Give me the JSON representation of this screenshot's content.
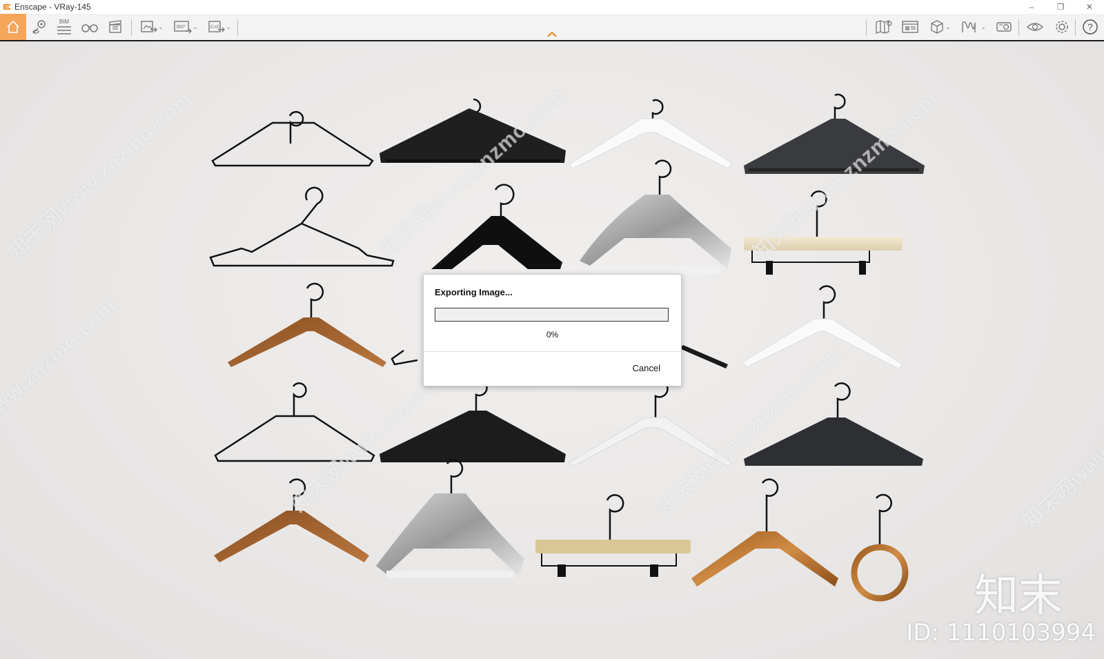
{
  "window": {
    "title": "Enscape - VRay-145",
    "minimize_icon": "minimize-icon",
    "restore_icon": "restore-icon",
    "close_icon": "close-icon"
  },
  "toolbar": {
    "accent_color": "#f5a65b",
    "left_tools": [
      "home-icon",
      "location-pin-icon",
      "bim-icon",
      "binoculars-icon",
      "clapperboard-icon",
      "export-image-icon",
      "export-panorama-icon",
      "export-exe-icon"
    ],
    "bim_label": "BIM",
    "panorama_label": "360°",
    "exe_label": "EXE",
    "right_tools": [
      "map-icon",
      "asset-library-icon",
      "cube-icon",
      "chart-icon",
      "projector-icon",
      "eye-icon",
      "settings-icon",
      "help-icon"
    ]
  },
  "watermarks": {
    "text": "知末网www.znzmo.com",
    "brand": "知末",
    "id": "ID: 1110103994"
  },
  "dialog": {
    "title": "Exporting Image...",
    "progress": 0,
    "percent_label": "0%",
    "cancel_label": "Cancel",
    "progress_color": "#3a8ee6"
  }
}
